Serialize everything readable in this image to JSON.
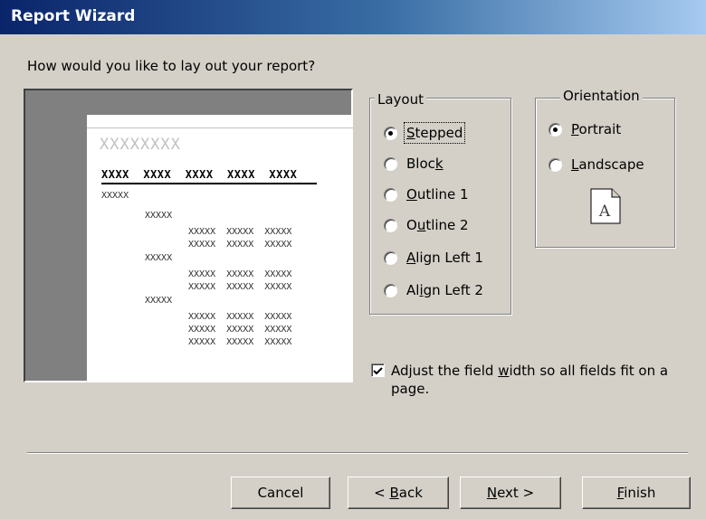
{
  "window": {
    "title": "Report Wizard"
  },
  "question": "How would you like to lay out your report?",
  "preview": {
    "title": "XXXXXXXX",
    "header": "XXXX  XXXX  XXXX  XXXX  XXXX",
    "group_value": "XXXXX",
    "detail_row": "XXXXX  XXXXX  XXXXX"
  },
  "layout": {
    "label": "Layout",
    "options": [
      {
        "before": "",
        "key": "S",
        "after": "tepped",
        "selected": true
      },
      {
        "before": "Bloc",
        "key": "k",
        "after": "",
        "selected": false
      },
      {
        "before": "",
        "key": "O",
        "after": "utline 1",
        "selected": false
      },
      {
        "before": "O",
        "key": "u",
        "after": "tline 2",
        "selected": false
      },
      {
        "before": "",
        "key": "A",
        "after": "lign Left 1",
        "selected": false
      },
      {
        "before": "Al",
        "key": "i",
        "after": "gn Left 2",
        "selected": false
      }
    ]
  },
  "orientation": {
    "label": "Orientation",
    "options": [
      {
        "before": "",
        "key": "P",
        "after": "ortrait",
        "selected": true
      },
      {
        "before": "",
        "key": "L",
        "after": "andscape",
        "selected": false
      }
    ],
    "icon_letter": "A"
  },
  "adjust": {
    "checked": true,
    "before": "Adjust the field ",
    "key": "w",
    "after": "idth so all fields fit on a page."
  },
  "buttons": {
    "cancel": {
      "before": "Cancel",
      "key": "",
      "after": ""
    },
    "back": {
      "before": "< ",
      "key": "B",
      "after": "ack"
    },
    "next": {
      "before": "",
      "key": "N",
      "after": "ext >"
    },
    "finish": {
      "before": "",
      "key": "F",
      "after": "inish"
    }
  }
}
